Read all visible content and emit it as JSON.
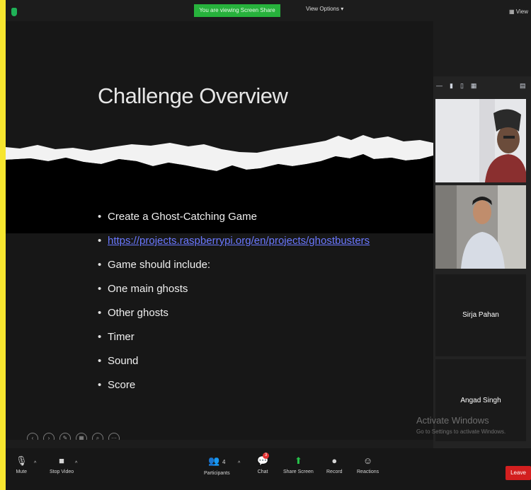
{
  "topbar": {
    "share_banner": "You are viewing Screen Share",
    "view_options": "View Options",
    "right_label": "View"
  },
  "slide": {
    "title": "Challenge Overview",
    "bullets": [
      "Create a Ghost-Catching Game",
      "https://projects.raspberrypi.org/en/projects/ghostbusters",
      "Game should include:",
      "One main ghosts",
      "Other ghosts",
      "Timer",
      "Sound",
      "Score"
    ]
  },
  "participants": {
    "tile1_name": "",
    "tile2_name": "",
    "tile3_name": "Sirja Pahan",
    "tile4_name": "Angad Singh"
  },
  "watermark": {
    "line1": "Activate Windows",
    "line2": "Go to Settings to activate Windows."
  },
  "toolbar": {
    "mute": "Mute",
    "stop_video": "Stop Video",
    "participants": "Participants",
    "participants_count": "4",
    "chat": "Chat",
    "chat_badge": "3",
    "share_screen": "Share Screen",
    "record": "Record",
    "reactions": "Reactions",
    "leave": "Leave"
  },
  "colors": {
    "frame": "#f7e62f",
    "share_banner": "#27b23c",
    "link": "#6a78ff",
    "leave": "#d31f1f"
  }
}
